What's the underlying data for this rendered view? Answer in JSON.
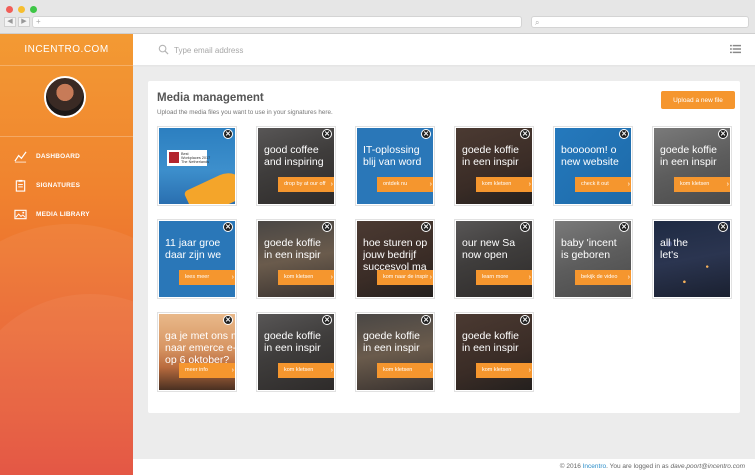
{
  "browser": {
    "url_placeholder": "+",
    "dots": [
      "#f15e58",
      "#f6be2f",
      "#3ec646"
    ]
  },
  "sidebar": {
    "brand": "INCENTRO.COM",
    "items": [
      {
        "label": "DASHBOARD",
        "icon": "chart-line-icon"
      },
      {
        "label": "SIGNATURES",
        "icon": "clipboard-icon"
      },
      {
        "label": "MEDIA LIBRARY",
        "icon": "image-icon"
      }
    ]
  },
  "topbar": {
    "search_placeholder": "Type email address"
  },
  "page": {
    "title": "Media management",
    "subtitle": "Upload the media files you want to use in your signatures here.",
    "upload_label": "Upload a new file"
  },
  "tiles": [
    {
      "headline": "",
      "cta": "",
      "award": "Best\nWorkplaces 2017\nThe Netherlands",
      "style": "award"
    },
    {
      "headline": "good coffee\nand inspiring",
      "cta": "drop by at our off",
      "style": "office"
    },
    {
      "headline": "IT-oplossing\nblij van word",
      "cta": "ontdek nu",
      "style": "blue"
    },
    {
      "headline": "goede koffie\nin een inspir",
      "cta": "kom kletsen",
      "style": "brown"
    },
    {
      "headline": "booooom! o\nnew website",
      "cta": "check it out",
      "style": "blue2"
    },
    {
      "headline": "goede koffie\nin een inspir",
      "cta": "kom kletsen",
      "style": "grey"
    },
    {
      "headline": "11 jaar groe\ndaar zijn we",
      "cta": "lees meer",
      "style": "blue"
    },
    {
      "headline": "goede koffie\nin een inspir",
      "cta": "kom kletsen",
      "style": "office2"
    },
    {
      "headline": "hoe sturen op\njouw bedrijf\nsuccesvol ma",
      "cta": "kom naar de inspir",
      "style": "brown"
    },
    {
      "headline": "our new Sa\nnow open",
      "cta": "learn more",
      "style": "office"
    },
    {
      "headline": "baby 'incent\nis geboren",
      "cta": "bekijk de video",
      "style": "grey"
    },
    {
      "headline": "all the\nlet's",
      "cta": "",
      "style": "night"
    },
    {
      "headline": "ga je met ons m\nnaar emerce e-\nop 6 oktober?",
      "cta": "meer info",
      "style": "beach"
    },
    {
      "headline": "goede koffie\nin een inspir",
      "cta": "kom kletsen",
      "style": "office"
    },
    {
      "headline": "goede koffie\nin een inspir",
      "cta": "kom kletsen",
      "style": "office2"
    },
    {
      "headline": "goede koffie\nin een inspir",
      "cta": "kom kletsen",
      "style": "brown"
    }
  ],
  "footer": {
    "prefix": "© 2016 ",
    "company": "Incentro",
    "mid": ". You are logged in as ",
    "user": "dave.poort@incentro.com"
  },
  "colors": {
    "accent": "#f5962e",
    "sidebar_top": "#f39a33",
    "sidebar_bottom": "#e2452f",
    "link": "#2a8dc9"
  }
}
